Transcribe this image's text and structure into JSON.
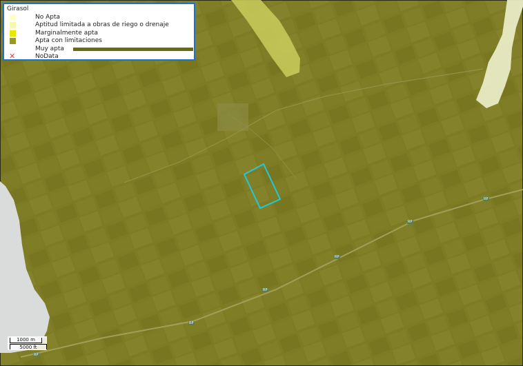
{
  "legend": {
    "title": "Girasol",
    "items": [
      {
        "label": "No Apta",
        "color": "#ffffcc",
        "icon": "swatch"
      },
      {
        "label": "Aptitud limitada a obras de riego o drenaje",
        "color": "#f6f7b0",
        "icon": "swatch"
      },
      {
        "label": "Marginalmente apta",
        "color": "#e8e800",
        "icon": "swatch"
      },
      {
        "label": "Apta con limitaciones",
        "color": "#9a9a22",
        "icon": "swatch"
      },
      {
        "label": "Muy apta",
        "color": "#6b6a10",
        "icon": "bar"
      },
      {
        "label": "NoData",
        "color": "#e04040",
        "icon": "x-mark-icon",
        "glyph": "✕"
      }
    ]
  },
  "scale": {
    "metric": "1000 m",
    "imperial": "5000 ft"
  },
  "road_labels": [
    "RP",
    "RP",
    "RP",
    "RP",
    "RP",
    "RP"
  ],
  "colors": {
    "field": "#7d7b24",
    "selection": "#23c8d8",
    "legend_border": "#1d73c9"
  }
}
